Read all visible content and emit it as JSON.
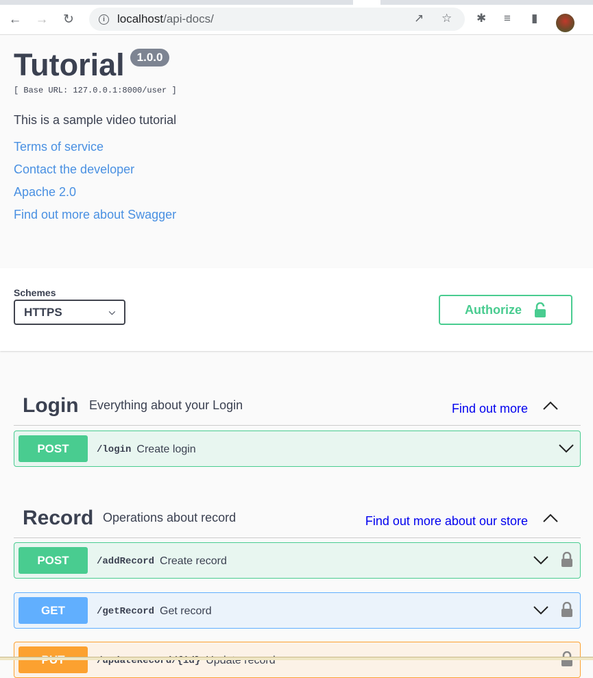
{
  "browser": {
    "url_host": "localhost",
    "url_path": "/api-docs/"
  },
  "info": {
    "title": "Tutorial",
    "version": "1.0.0",
    "base_url": "[ Base URL: 127.0.0.1:8000/user ]",
    "description": "This is a sample video tutorial",
    "links": [
      "Terms of service",
      "Contact the developer",
      "Apache 2.0",
      "Find out more about Swagger"
    ]
  },
  "schemes": {
    "label": "Schemes",
    "selected": "HTTPS",
    "authorize_label": "Authorize"
  },
  "tags": [
    {
      "name": "Login",
      "description": "Everything about your Login",
      "link": "Find out more",
      "operations": [
        {
          "method": "POST",
          "path": "/login",
          "summary": "Create login",
          "locked": false
        }
      ]
    },
    {
      "name": "Record",
      "description": "Operations about record",
      "link": "Find out more about our store",
      "operations": [
        {
          "method": "POST",
          "path": "/addRecord",
          "summary": "Create record",
          "locked": true
        },
        {
          "method": "GET",
          "path": "/getRecord",
          "summary": "Get record",
          "locked": true
        },
        {
          "method": "PUT",
          "path": "/updateRecord/{id}",
          "summary": "Update record",
          "locked": true
        }
      ]
    }
  ],
  "colors": {
    "post": "#49cc90",
    "get": "#61affe",
    "put": "#fca130",
    "link": "#4990e2"
  }
}
